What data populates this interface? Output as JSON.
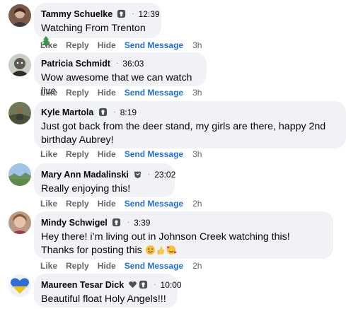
{
  "actions": {
    "like": "Like",
    "reply": "Reply",
    "hide": "Hide",
    "send_message": "Send Message"
  },
  "comments": [
    {
      "name": "Tammy Schuelke",
      "badge_icon": "top-fan-badge-icon",
      "time": "12:39",
      "text": "Watching From Trenton",
      "emoji": "christmas-tree-icon",
      "ago": "3h"
    },
    {
      "name": "Patricia Schmidt",
      "time": "36:03",
      "text": "Wow awesome that we can watch live",
      "ago": "3h"
    },
    {
      "name": "Kyle Martola",
      "badge_icon": "top-fan-badge-icon",
      "time": "8:19",
      "text": "Just got back from the deer stand, my girls are there, happy 2nd birthday Aubrey!",
      "ago": "3h"
    },
    {
      "name": "Mary Ann Madalinski",
      "badge_icon": "fan-badge-icon",
      "time": "23:02",
      "text": "Really enjoying this!",
      "ago": "2h"
    },
    {
      "name": "Mindy Schwigel",
      "badge_icon": "top-fan-badge-icon",
      "time": "3:39",
      "text": "Hey there! i’m living out in Johnson Creek watching this! Thanks for posting this",
      "emoji": "wink-thumbsup-love-emojis",
      "ago": "2h"
    },
    {
      "name": "Maureen Tesar Dick",
      "badge_icon": "fan-badge-icon",
      "time": "10:00",
      "text": "Beautiful float Holy Angels!!!"
    }
  ],
  "colors": {
    "bubble": "#f0f2f5",
    "link": "#216fdb",
    "meta": "#65676b"
  }
}
